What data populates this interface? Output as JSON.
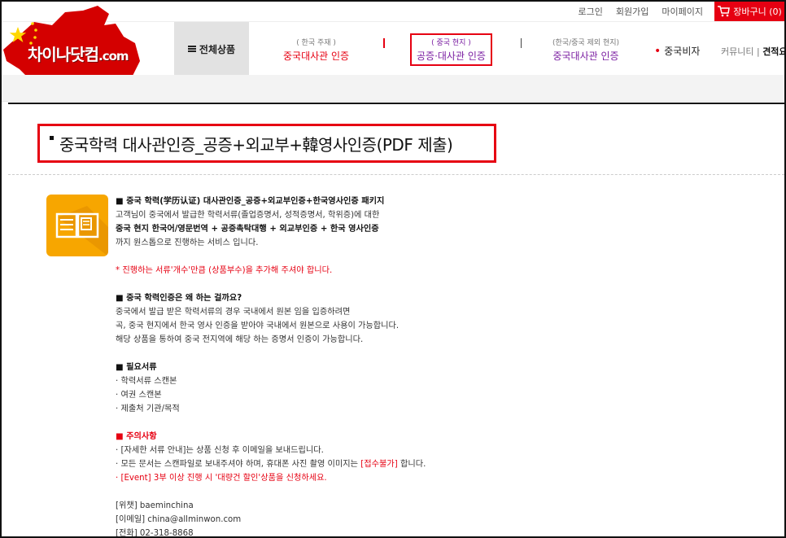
{
  "topbar": {
    "links": [
      "로그인",
      "회원가입",
      "마이페이지"
    ],
    "cart_label": "장바구니 (0)"
  },
  "brand": {
    "name": "차이나닷컴",
    "suffix": ".com"
  },
  "nav": {
    "all_products": "전체상품",
    "items": [
      {
        "sub": "( 한국 주재 )",
        "label": "중국대사관 인증"
      },
      {
        "sub": "( 중국 현지 )",
        "label": "공증·대사관 인증"
      },
      {
        "sub": "(한국/중국 제외 현지)",
        "label": "중국대사관 인증"
      }
    ],
    "visa": "중국비자",
    "community": "커뮤니티 |",
    "estimate": "견적요청"
  },
  "product": {
    "title": "중국학력 대사관인증_공증+외교부+韓영사인증(PDF 제출)"
  },
  "content": {
    "section1": {
      "heading": "■ 중국 학력(学历认证) 대사관인증_공증+외교부인증+한국영사인증 패키지",
      "lines": [
        "고객님이 중국에서 발급한 학력서류(졸업증명서, 성적증명서, 학위증)에 대한",
        "중국 현지 한국어/영문번역 + 공증촉탁대행 + 외교부인증 + 한국 영사인증",
        "까지 원스톱으로 진행하는 서비스 입니다."
      ]
    },
    "notice": "* 진행하는 서류'개수'만큼 (상품부수)을 추가해 주셔야 합니다.",
    "section2": {
      "heading": "■ 중국 학력인증은 왜 하는 걸까요?",
      "lines": [
        "중국에서 발급 받은 학력서류의 경우 국내에서 원본 임을 입증하려면",
        "곡, 중국 현지에서 한국 영사 인증을 받아야 국내에서 원본으로 사용이 가능합니다.",
        "해당 상품을 통하여 중국 전지역에 해당 하는 증명서 인증이 가능합니다."
      ]
    },
    "section3": {
      "heading": "■ 필요서류",
      "lines": [
        "· 학력서류 스캔본",
        "· 여권 스캔본",
        "· 제출처 기관/목적"
      ]
    },
    "section4": {
      "heading": "■ 주의사항",
      "line1": "· [자세한 서류 안내]는 상품 신청 후 이메일을 보내드립니다.",
      "line2_pre": "· 모든 문서는 스캔파일로 보내주셔야 하며, 휴대폰 사진 촬영 이미지는 ",
      "line2_red": "[접수불가]",
      "line2_post": " 합니다.",
      "line3": "· [Event] 3부 이상 진행 시 '대량건 할인'상품을 신청하세요."
    },
    "contact": {
      "wechat": "[위챗] baeminchina",
      "email": "[이메일] china@allminwon.com",
      "phone": "[전화] 02-318-8868"
    }
  },
  "colors": {
    "accent": "#e60012",
    "purple": "#7b1fa2",
    "icon_bg": "#f7a600"
  }
}
